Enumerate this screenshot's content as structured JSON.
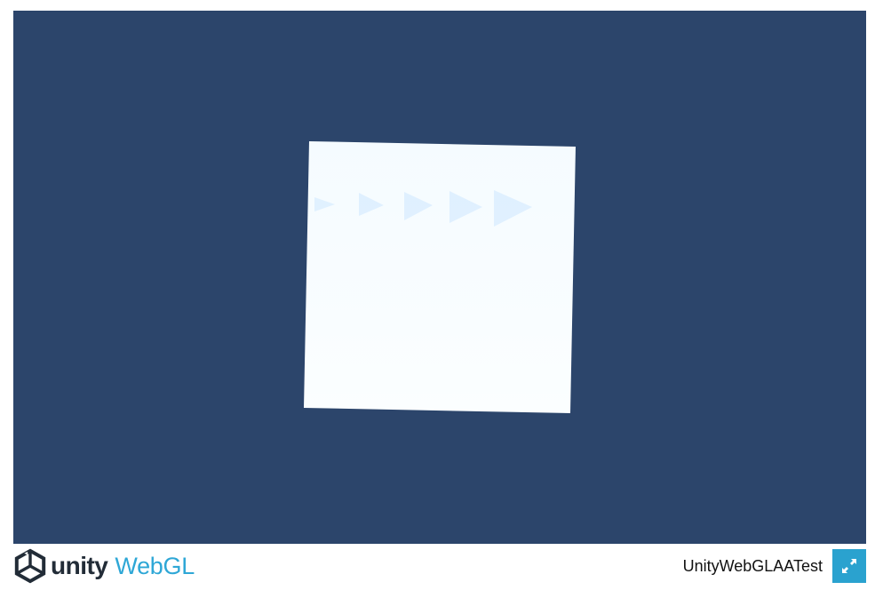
{
  "canvas": {
    "background": "#2c456b",
    "quad_color": "#f7fcff",
    "arrow_color": "#ddf0fc",
    "arrow_count": 5
  },
  "footer": {
    "logo": {
      "mark_icon": "unity-cube-logo-icon",
      "brand_text": "unity",
      "product_text": "WebGL",
      "brand_color": "#222c37",
      "product_color": "#2ea7d6"
    },
    "build_title": "UnityWebGLAATest",
    "fullscreen_button": {
      "icon": "fullscreen-expand-icon",
      "color": "#2aa2cf"
    }
  }
}
